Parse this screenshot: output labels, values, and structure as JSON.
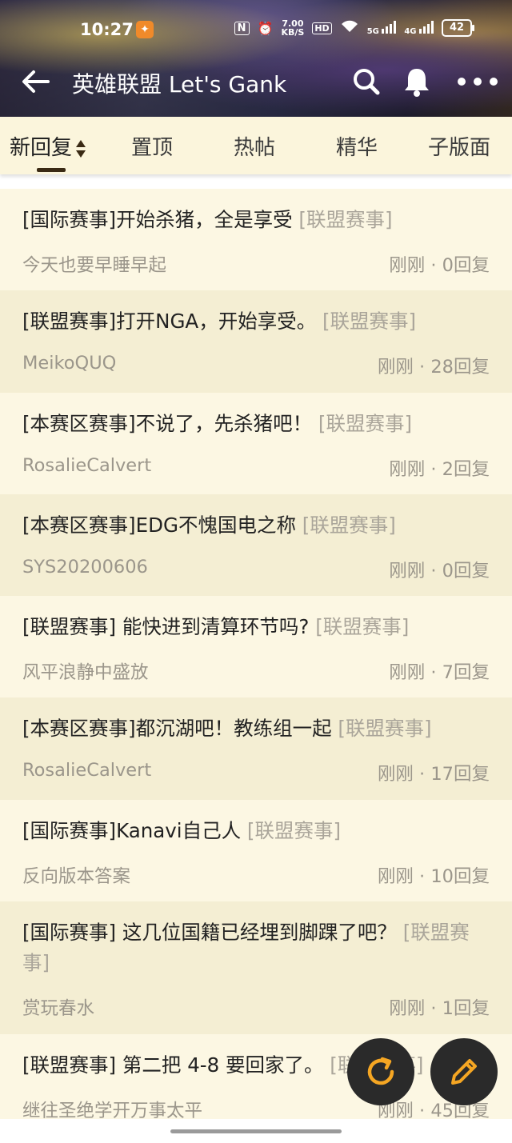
{
  "status_bar": {
    "time": "10:27",
    "app_icon": "🔑",
    "nfc": "N",
    "speed_top": "7.00",
    "speed_bottom": "KB/S",
    "hd": "HD",
    "signal1": "5G",
    "signal2": "4G",
    "battery": "42"
  },
  "titlebar": {
    "title": "英雄联盟 Let's Gank",
    "icons": [
      "back-arrow-icon",
      "search-icon",
      "bell-icon",
      "more-icon"
    ]
  },
  "tabs": [
    {
      "label": "新回复",
      "active": true
    },
    {
      "label": "置顶"
    },
    {
      "label": "热帖"
    },
    {
      "label": "精华"
    },
    {
      "label": "子版面"
    }
  ],
  "posts": [
    {
      "title": "[国际赛事]开始杀猪，全是享受",
      "tag": "[联盟赛事]",
      "author": "今天也要早睡早起",
      "meta": "刚刚 · 0回复"
    },
    {
      "title": "[联盟赛事]打开NGA，开始享受。",
      "tag": "[联盟赛事]",
      "author": "MeikoQUQ",
      "meta": "刚刚 · 28回复"
    },
    {
      "title": "[本赛区赛事]不说了，先杀猪吧！",
      "tag": "[联盟赛事]",
      "author": "RosalieCalvert",
      "meta": "刚刚 · 2回复"
    },
    {
      "title": "[本赛区赛事]EDG不愧国电之称",
      "tag": "[联盟赛事]",
      "author": "SYS20200606",
      "meta": "刚刚 · 0回复"
    },
    {
      "title": "[联盟赛事] 能快进到清算环节吗?",
      "tag": "[联盟赛事]",
      "author": "风平浪静中盛放",
      "meta": "刚刚 · 7回复"
    },
    {
      "title": "[本赛区赛事]都沉湖吧！教练组一起",
      "tag": "[联盟赛事]",
      "author": "RosalieCalvert",
      "meta": "刚刚 · 17回复"
    },
    {
      "title": "[国际赛事]Kanavi自己人",
      "tag": "[联盟赛事]",
      "author": "反向版本答案",
      "meta": "刚刚 · 10回复"
    },
    {
      "title": "[国际赛事] 这几位国籍已经埋到脚踝了吧？",
      "tag": "[联盟赛事]",
      "author": "赏玩春水",
      "meta": "刚刚 · 1回复"
    },
    {
      "title": "[联盟赛事] 第二把 4-8 要回家了。",
      "tag": "[联盟赛事]",
      "author": "继往圣绝学开万事太平",
      "meta": "刚刚 · 45回复"
    }
  ],
  "fabs": [
    "refresh-icon",
    "edit-icon"
  ],
  "colors": {
    "tab_bg": "#fbf5dc",
    "row_light": "#fcf7e3",
    "row_dark": "#f4eed3",
    "fab_icon": "#f5a623"
  }
}
